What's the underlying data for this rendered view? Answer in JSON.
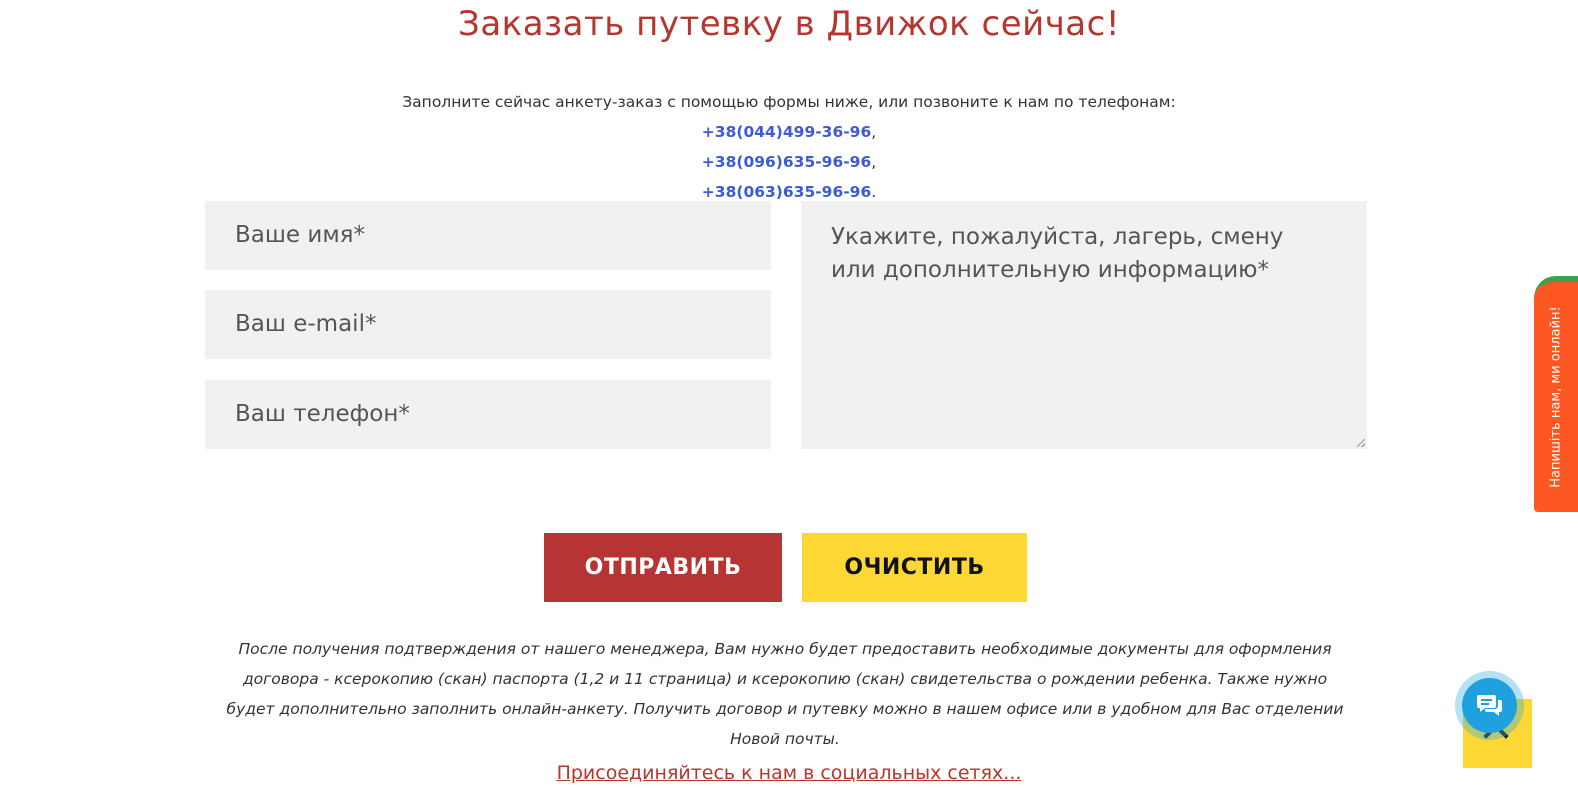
{
  "header": {
    "title": "Заказать путевку в Движок сейчас!"
  },
  "intro": {
    "text": "Заполните сейчас анкету-заказ с помощью формы ниже, или позвоните к нам по телефонам:",
    "phones": [
      {
        "number": "+38(044)499-36-96",
        "sep": ","
      },
      {
        "number": "+38(096)635-96-96",
        "sep": ","
      },
      {
        "number": "+38(063)635-96-96",
        "sep": "."
      }
    ]
  },
  "form": {
    "name_placeholder": "Ваше имя*",
    "email_placeholder": "Ваш e-mail*",
    "phone_placeholder": "Ваш телефон*",
    "message_placeholder": "Укажите, пожалуйста, лагерь, смену или дополнительную информацию*",
    "submit_label": "ОТПРАВИТЬ",
    "clear_label": "ОЧИСТИТЬ"
  },
  "note": "После получения подтверждения от нашего менеджера, Вам нужно будет предоставить необходимые документы для оформления договора - ксерокопию (скан) паспорта (1,2 и 11 страница) и ксерокопию (скан) свидетельства о рождении ребенка. Также нужно будет дополнительно заполнить онлайн-анкету. Получить договор и путевку можно в нашем офисе или в удобном для Вас отделении Новой почты.",
  "social_link": "Присоединяйтесь к нам в социальных сетях...",
  "widgets": {
    "side_tab_label": "Напишіть нам, ми онлайн!",
    "chat_icon": "chat-icon",
    "scroll_top_icon": "chevron-up-icon"
  },
  "colors": {
    "accent_red": "#b73434",
    "accent_yellow": "#fdd835",
    "link_blue": "#3d5bd9",
    "widget_orange": "#ff5722",
    "chat_blue": "#1fa1e0"
  }
}
